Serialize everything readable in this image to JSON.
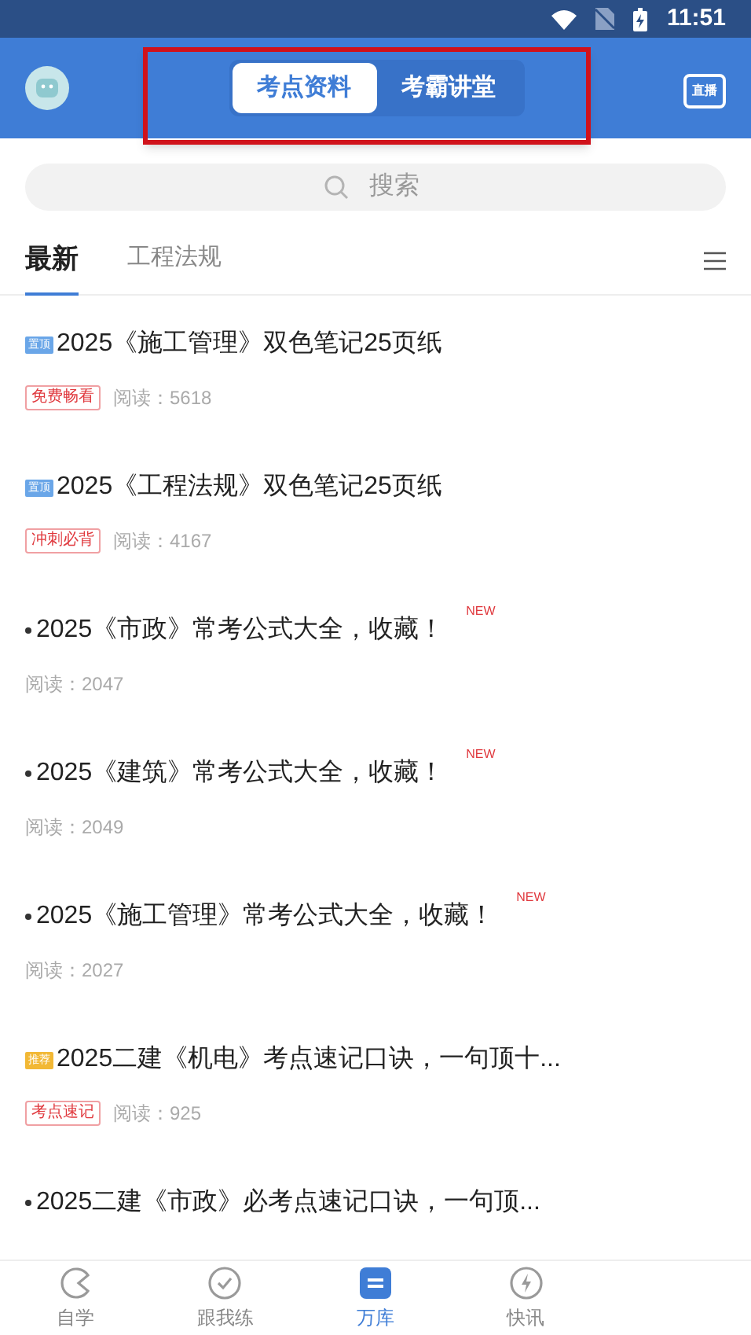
{
  "status_bar": {
    "time": "11:51"
  },
  "header": {
    "tabs": [
      {
        "label": "考点资料",
        "selected": true
      },
      {
        "label": "考霸讲堂",
        "selected": false
      }
    ],
    "live_label": "直播"
  },
  "search": {
    "placeholder": "搜索"
  },
  "category_tabs": [
    {
      "label": "最新",
      "selected": true
    },
    {
      "label": "工程法规",
      "selected": false
    }
  ],
  "articles": [
    {
      "kind": "badge",
      "badge": "置顶",
      "color": "#6aa6e8",
      "title": "2025《施工管理》双色笔记25页纸",
      "tag": "免费畅看",
      "reads": "阅读：5618"
    },
    {
      "kind": "badge",
      "badge": "置顶",
      "color": "#6aa6e8",
      "title": "2025《工程法规》双色笔记25页纸",
      "tag": "冲刺必背",
      "reads": "阅读：4167"
    },
    {
      "kind": "bullet",
      "title": "2025《市政》常考公式大全，收藏！",
      "new": "NEW",
      "reads": "阅读：2047"
    },
    {
      "kind": "bullet",
      "title": "2025《建筑》常考公式大全，收藏！",
      "new": "NEW",
      "reads": "阅读：2049"
    },
    {
      "kind": "bullet",
      "title": "2025《施工管理》常考公式大全，收藏！",
      "new": "NEW",
      "reads": "阅读：2027"
    },
    {
      "kind": "badge",
      "badge": "推荐",
      "color": "#f2b835",
      "title": "2025二建《机电》考点速记口诀，一句顶十...",
      "tag": "考点速记",
      "reads": "阅读：925"
    },
    {
      "kind": "bullet",
      "title": "2025二建《市政》必考点速记口诀，一句顶..."
    }
  ],
  "bottom_nav": [
    {
      "label": "自学",
      "selected": false
    },
    {
      "label": "跟我练",
      "selected": false
    },
    {
      "label": "万库",
      "selected": true
    },
    {
      "label": "快讯",
      "selected": false
    }
  ]
}
